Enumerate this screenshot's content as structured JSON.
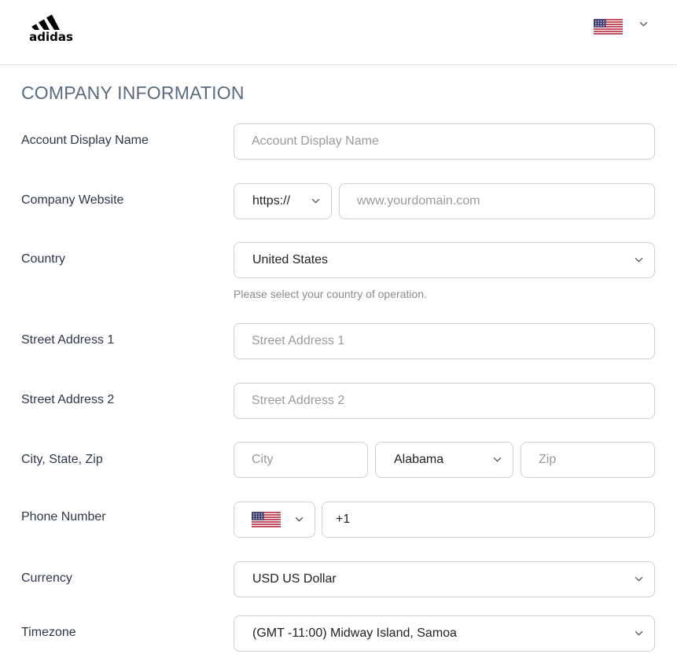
{
  "header": {
    "brand": "adidas",
    "language_flag": "us-flag-icon"
  },
  "page_title": "COMPANY INFORMATION",
  "form": {
    "account_display_name": {
      "label": "Account Display Name",
      "placeholder": "Account Display Name",
      "value": ""
    },
    "company_website": {
      "label": "Company Website",
      "protocol": "https://",
      "placeholder": "www.yourdomain.com",
      "value": ""
    },
    "country": {
      "label": "Country",
      "value": "United States",
      "hint": "Please select your country of operation."
    },
    "street_address_1": {
      "label": "Street Address 1",
      "placeholder": "Street Address 1",
      "value": ""
    },
    "street_address_2": {
      "label": "Street Address 2",
      "placeholder": "Street Address 2",
      "value": ""
    },
    "city_state_zip": {
      "label": "City, State, Zip",
      "city_placeholder": "City",
      "state": "Alabama",
      "zip_placeholder": "Zip"
    },
    "phone_number": {
      "label": "Phone Number",
      "country_flag": "us-flag-icon",
      "value": "+1"
    },
    "currency": {
      "label": "Currency",
      "value": "USD US Dollar"
    },
    "timezone": {
      "label": "Timezone",
      "value": "(GMT -11:00) Midway Island, Samoa"
    }
  },
  "colors": {
    "title": "#5a6b7d",
    "label": "#2d3748",
    "border": "#cfcfcf",
    "placeholder": "#9a9a9a",
    "flag_red": "#b22234",
    "flag_blue": "#3c3b6e"
  }
}
